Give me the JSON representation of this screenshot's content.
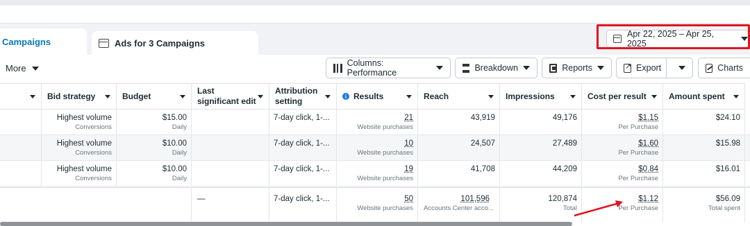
{
  "tabs": [
    {
      "label": "Campaigns"
    },
    {
      "label": "Ads for 3 Campaigns"
    }
  ],
  "date_range": {
    "label": "Apr 22, 2025 – Apr 25, 2025"
  },
  "toolbar": {
    "more": "More",
    "columns": "Columns: Performance",
    "breakdown": "Breakdown",
    "reports": "Reports",
    "export": "Export",
    "charts": "Charts"
  },
  "headers": {
    "bid_strategy": "Bid strategy",
    "budget": "Budget",
    "last_edit": "Last significant edit",
    "attribution": "Attribution setting",
    "results": "Results",
    "reach": "Reach",
    "impressions": "Impressions",
    "cpr": "Cost per result",
    "amount": "Amount spent"
  },
  "rows": [
    {
      "bid": "Highest volume",
      "bid_sub": "Conversions",
      "budget": "$15.00",
      "budget_sub": "Daily",
      "attribution": "7-day click, 1-...",
      "results": "21",
      "results_sub": "Website purchases",
      "reach": "43,919",
      "impressions": "49,176",
      "cpr": "$1.15",
      "cpr_sub": "Per Purchase",
      "amount": "$24.10"
    },
    {
      "bid": "Highest volume",
      "bid_sub": "Conversions",
      "budget": "$10.00",
      "budget_sub": "Daily",
      "attribution": "7-day click, 1-...",
      "results": "10",
      "results_sub": "Website purchases",
      "reach": "24,507",
      "impressions": "27,489",
      "cpr": "$1.60",
      "cpr_sub": "Per Purchase",
      "amount": "$15.98"
    },
    {
      "bid": "Highest volume",
      "bid_sub": "Conversions",
      "budget": "$10.00",
      "budget_sub": "Daily",
      "attribution": "7-day click, 1-...",
      "results": "19",
      "results_sub": "Website purchases",
      "reach": "41,708",
      "impressions": "44,209",
      "cpr": "$0.84",
      "cpr_sub": "Per Purchase",
      "amount": "$16.01"
    }
  ],
  "totals": {
    "last_edit": "—",
    "attribution": "7-day click, 1-...",
    "results": "50",
    "results_sub": "Website purchases",
    "reach": "101,596",
    "reach_sub": "Accounts Center acco...",
    "impressions": "120,874",
    "impressions_sub": "Total",
    "cpr": "$1.12",
    "cpr_sub": "Per Purchase",
    "amount": "$56.09",
    "amount_sub": "Total spent"
  },
  "colors": {
    "accent": "#0a78be",
    "highlight": "#e0141e"
  }
}
